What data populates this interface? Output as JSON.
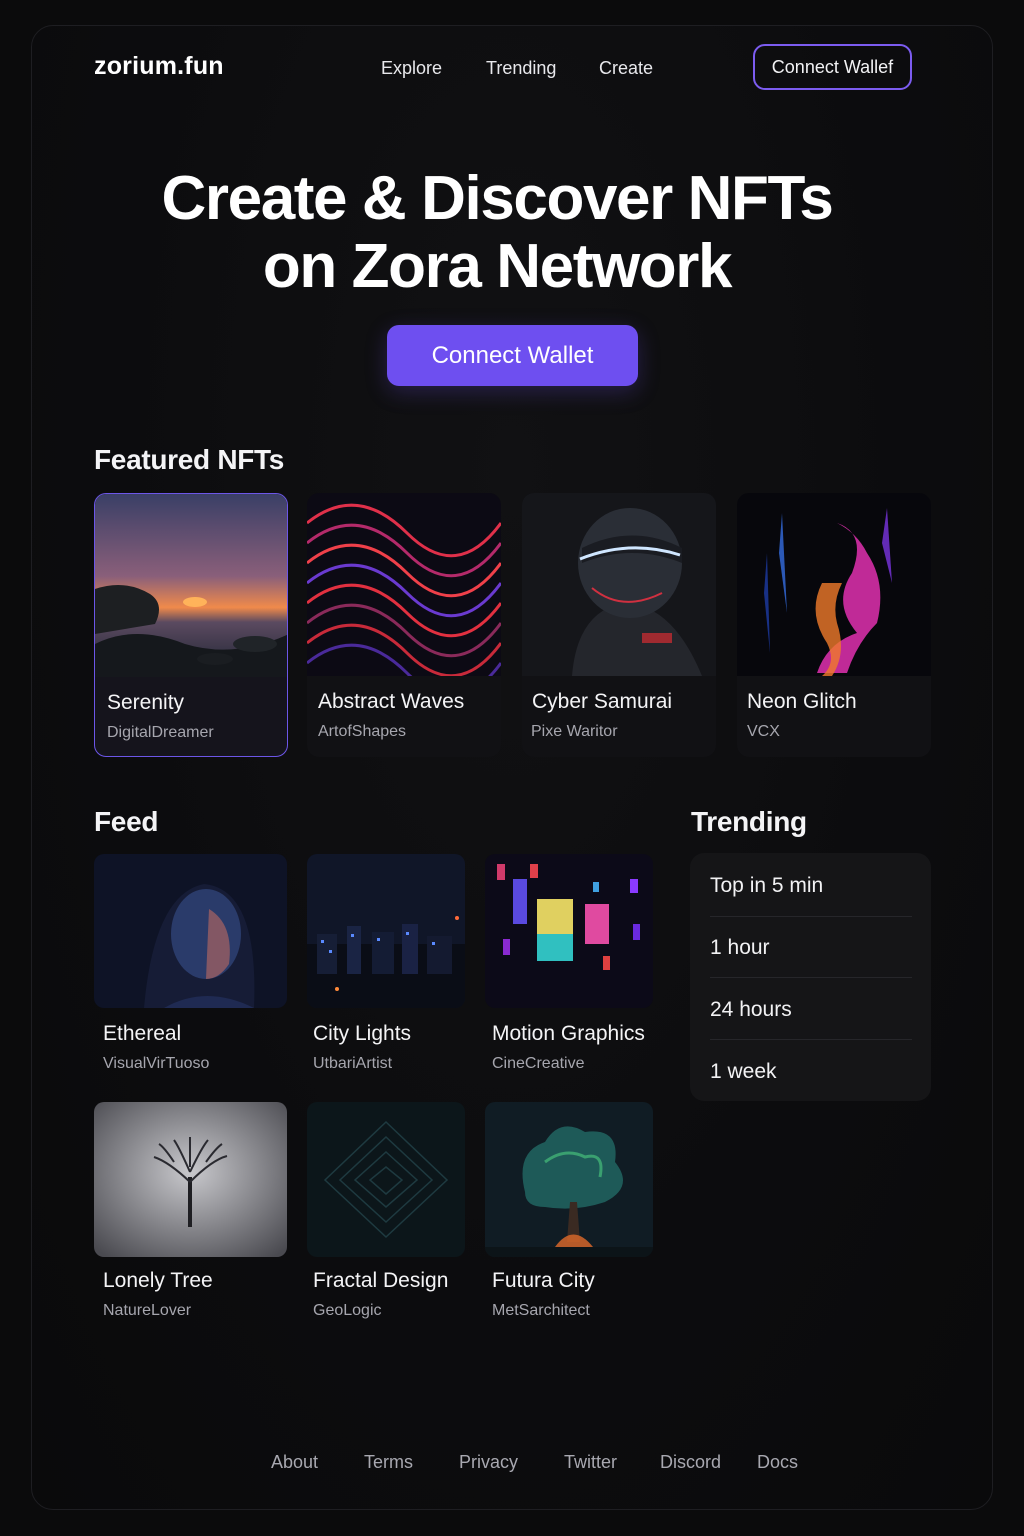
{
  "brand": {
    "logo": "zorium.fun",
    "accent": "#6e4ff0",
    "outline": "#7c5cf0"
  },
  "nav": {
    "explore": "Explore",
    "trending": "Trending",
    "create": "Create",
    "connect_label": "Connect Wallef"
  },
  "hero": {
    "line1": "Create & Discover NFTs",
    "line2": "on Zora Network",
    "cta": "Connect Wallet"
  },
  "featured": {
    "title": "Featured NFTs",
    "items": [
      {
        "title": "Serenity",
        "creator": "DigitalDreamer",
        "art": "sunset-sea"
      },
      {
        "title": "Abstract Waves",
        "creator": "ArtofShapes",
        "art": "red-waves"
      },
      {
        "title": "Cyber Samurai",
        "creator": "Pixe Waritor",
        "art": "cyber-helmet"
      },
      {
        "title": "Neon Glitch",
        "creator": "VCX",
        "art": "neon-smoke"
      }
    ]
  },
  "feed": {
    "title": "Feed",
    "items": [
      {
        "title": "Ethereal",
        "creator": "VisualVirTuoso",
        "art": "portrait"
      },
      {
        "title": "City Lights",
        "creator": "UtbariArtist",
        "art": "night-city"
      },
      {
        "title": "Motion Graphics",
        "creator": "CineCreative",
        "art": "neon-blocks"
      },
      {
        "title": "Lonely Tree",
        "creator": "NatureLover",
        "art": "foggy-tree"
      },
      {
        "title": "Fractal Design",
        "creator": "GeoLogic",
        "art": "fractal"
      },
      {
        "title": "Futura City",
        "creator": "MetSarchitect",
        "art": "glow-tree"
      }
    ]
  },
  "trending": {
    "title": "Trending",
    "items": [
      "Top in 5 min",
      "1 hour",
      "24 hours",
      "1 week"
    ]
  },
  "footer": {
    "about": "About",
    "terms": "Terms",
    "privacy": "Privacy",
    "twitter": "Twitter",
    "discord": "Discord",
    "docs": "Docs"
  }
}
